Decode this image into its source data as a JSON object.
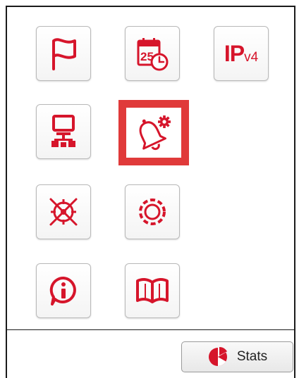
{
  "colors": {
    "accent": "#d6152b",
    "selection": "#e03a3a",
    "frame": "#1a1a1a"
  },
  "tiles": [
    {
      "icon": "flag-icon"
    },
    {
      "icon": "calendar-clock-icon",
      "calendar_day": "25"
    },
    {
      "icon": "ipv4-icon",
      "ip_text": "IP",
      "version_text": "v4"
    },
    {
      "icon": "network-computer-icon"
    },
    {
      "icon": "bell-settings-icon",
      "selected": true
    },
    {
      "icon": "crossed-target-icon"
    },
    {
      "icon": "dashed-circle-icon"
    },
    {
      "icon": "info-bubble-icon"
    },
    {
      "icon": "open-book-icon"
    }
  ],
  "footer": {
    "stats_label": "Stats",
    "stats_icon": "pie-chart-icon"
  }
}
